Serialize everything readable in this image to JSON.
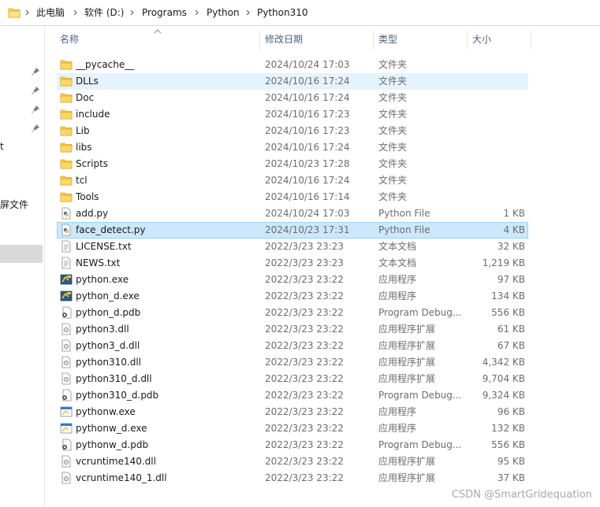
{
  "breadcrumb": [
    "此电脑",
    "软件 (D:)",
    "Programs",
    "Python",
    "Python310"
  ],
  "columns": {
    "name": "名称",
    "date": "修改日期",
    "type": "类型",
    "size": "大小"
  },
  "nav_fragments": [
    "t",
    "屏文件"
  ],
  "files": [
    {
      "name": "__pycache__",
      "date": "2024/10/24 17:03",
      "type": "文件夹",
      "size": "",
      "icon": "folder"
    },
    {
      "name": "DLLs",
      "date": "2024/10/16 17:24",
      "type": "文件夹",
      "size": "",
      "icon": "folder",
      "state": "hover"
    },
    {
      "name": "Doc",
      "date": "2024/10/16 17:24",
      "type": "文件夹",
      "size": "",
      "icon": "folder"
    },
    {
      "name": "include",
      "date": "2024/10/16 17:23",
      "type": "文件夹",
      "size": "",
      "icon": "folder"
    },
    {
      "name": "Lib",
      "date": "2024/10/16 17:23",
      "type": "文件夹",
      "size": "",
      "icon": "folder"
    },
    {
      "name": "libs",
      "date": "2024/10/16 17:24",
      "type": "文件夹",
      "size": "",
      "icon": "folder"
    },
    {
      "name": "Scripts",
      "date": "2024/10/23 17:28",
      "type": "文件夹",
      "size": "",
      "icon": "folder"
    },
    {
      "name": "tcl",
      "date": "2024/10/16 17:24",
      "type": "文件夹",
      "size": "",
      "icon": "folder"
    },
    {
      "name": "Tools",
      "date": "2024/10/16 17:14",
      "type": "文件夹",
      "size": "",
      "icon": "folder"
    },
    {
      "name": "add.py",
      "date": "2024/10/24 17:03",
      "type": "Python File",
      "size": "1 KB",
      "icon": "python-file"
    },
    {
      "name": "face_detect.py",
      "date": "2024/10/23 17:31",
      "type": "Python File",
      "size": "4 KB",
      "icon": "python-file",
      "state": "selected"
    },
    {
      "name": "LICENSE.txt",
      "date": "2022/3/23 23:23",
      "type": "文本文档",
      "size": "32 KB",
      "icon": "text-file"
    },
    {
      "name": "NEWS.txt",
      "date": "2022/3/23 23:23",
      "type": "文本文档",
      "size": "1,219 KB",
      "icon": "text-file"
    },
    {
      "name": "python.exe",
      "date": "2022/3/23 23:22",
      "type": "应用程序",
      "size": "97 KB",
      "icon": "python-exe"
    },
    {
      "name": "python_d.exe",
      "date": "2022/3/23 23:22",
      "type": "应用程序",
      "size": "134 KB",
      "icon": "python-exe"
    },
    {
      "name": "python_d.pdb",
      "date": "2022/3/23 23:22",
      "type": "Program Debug...",
      "size": "556 KB",
      "icon": "pdb-file"
    },
    {
      "name": "python3.dll",
      "date": "2022/3/23 23:22",
      "type": "应用程序扩展",
      "size": "61 KB",
      "icon": "dll-file"
    },
    {
      "name": "python3_d.dll",
      "date": "2022/3/23 23:22",
      "type": "应用程序扩展",
      "size": "67 KB",
      "icon": "dll-file"
    },
    {
      "name": "python310.dll",
      "date": "2022/3/23 23:22",
      "type": "应用程序扩展",
      "size": "4,342 KB",
      "icon": "dll-file"
    },
    {
      "name": "python310_d.dll",
      "date": "2022/3/23 23:22",
      "type": "应用程序扩展",
      "size": "9,704 KB",
      "icon": "dll-file"
    },
    {
      "name": "python310_d.pdb",
      "date": "2022/3/23 23:22",
      "type": "Program Debug...",
      "size": "9,324 KB",
      "icon": "pdb-file"
    },
    {
      "name": "pythonw.exe",
      "date": "2022/3/23 23:22",
      "type": "应用程序",
      "size": "96 KB",
      "icon": "pythonw-exe"
    },
    {
      "name": "pythonw_d.exe",
      "date": "2022/3/23 23:22",
      "type": "应用程序",
      "size": "132 KB",
      "icon": "pythonw-exe"
    },
    {
      "name": "pythonw_d.pdb",
      "date": "2022/3/23 23:22",
      "type": "Program Debug...",
      "size": "556 KB",
      "icon": "pdb-file"
    },
    {
      "name": "vcruntime140.dll",
      "date": "2022/3/23 23:22",
      "type": "应用程序扩展",
      "size": "95 KB",
      "icon": "dll-file"
    },
    {
      "name": "vcruntime140_1.dll",
      "date": "2022/3/23 23:22",
      "type": "应用程序扩展",
      "size": "37 KB",
      "icon": "dll-file"
    }
  ],
  "watermark": "CSDN @SmartGridequation",
  "colors": {
    "hover": "#e5f3ff",
    "selected": "#cce8ff",
    "selected_border": "#99d1ff",
    "folder": "#ffd35c",
    "header_text": "#4d6082"
  }
}
